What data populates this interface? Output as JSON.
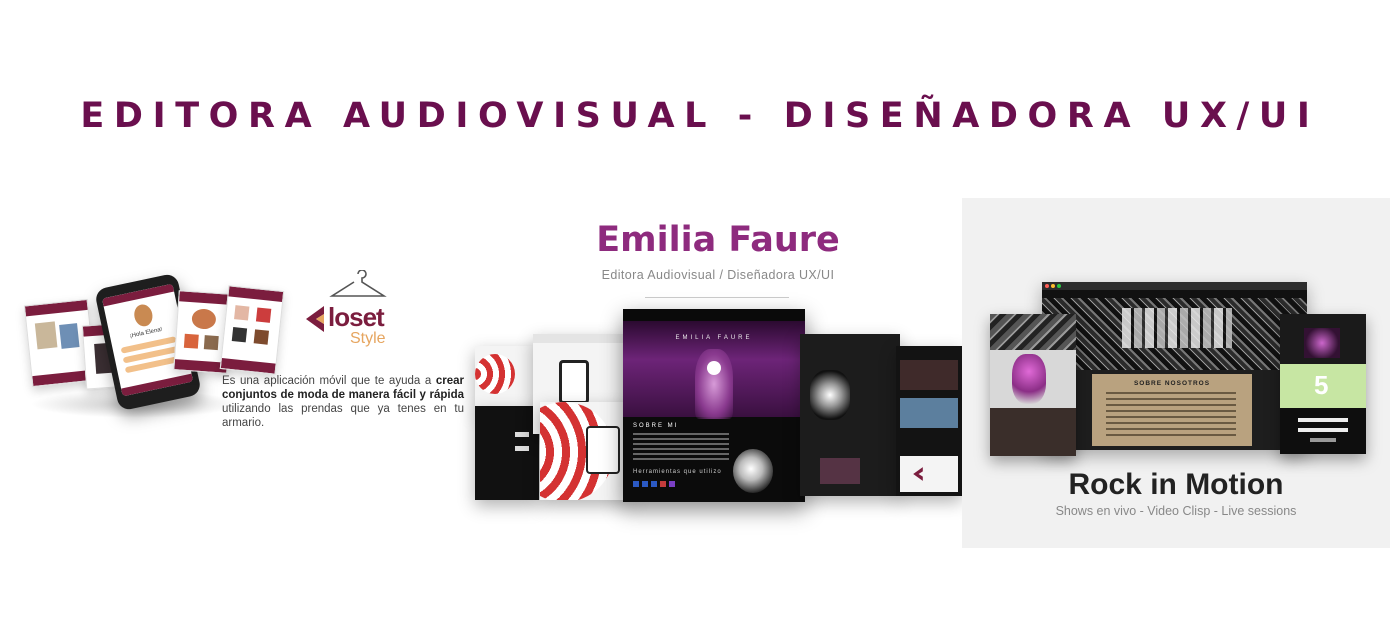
{
  "headline": "EDITORA AUDIOVISUAL - DISEÑADORA UX/UI",
  "closet": {
    "brand_main": "loset",
    "brand_sub": "Style",
    "phone_greeting": "¡Hola Elena!",
    "description_pre": "Es una aplicación móvil que te ayuda a ",
    "description_bold_1": "crear conjuntos de moda de manera fácil y rápida",
    "description_post": " utilizando las prendas que ya tenes en tu armario.",
    "colors": {
      "primary": "#7b1d3e",
      "accent": "#e6a55f"
    },
    "icon": "hanger-icon"
  },
  "emilia": {
    "title": "Emilia Faure",
    "subtitle": "Editora Audiovisual / Diseñadora UX/UI",
    "site_name": "EMILIA FAURE",
    "site_section": "SOBRE MI",
    "site_tools": "Herramientas que utilizo",
    "colors": {
      "title": "#8e2b7e"
    }
  },
  "rock": {
    "title": "Rock in Motion",
    "subtitle": "Shows en vivo - Video Clisp - Live sessions",
    "about_heading": "SOBRE NOSOTROS",
    "phone_number": "5"
  }
}
